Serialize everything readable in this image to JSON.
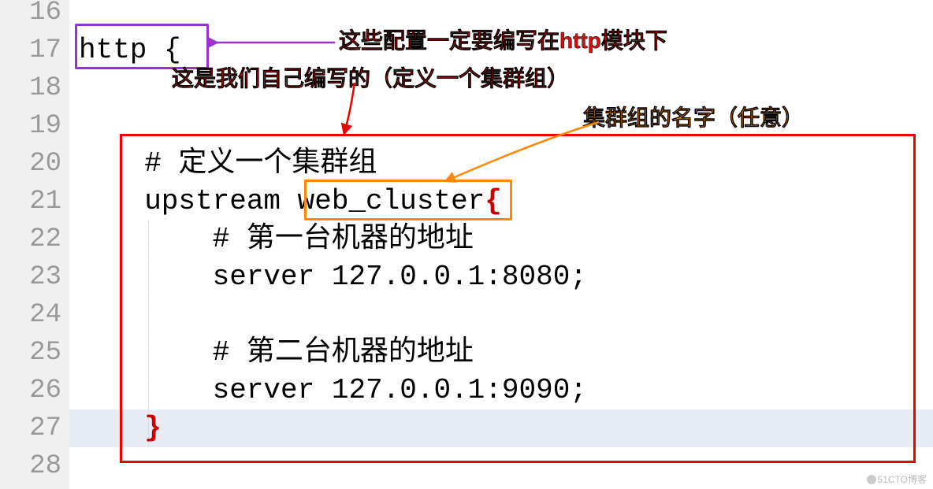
{
  "line_numbers": [
    "16",
    "17",
    "18",
    "19",
    "20",
    "21",
    "22",
    "23",
    "24",
    "25",
    "26",
    "27",
    "28"
  ],
  "code": {
    "l17": "http {",
    "l20": "  # 定义一个集群组",
    "l21_pre": "  upstream ",
    "l21_name": "web_cluster",
    "l21_brace": "{",
    "l22": "      # 第一台机器的地址",
    "l23": "      server 127.0.0.1:8080;",
    "l25": "      # 第二台机器的地址",
    "l26": "      server 127.0.0.1:9090;",
    "l27_brace": "  }"
  },
  "annotations": {
    "http_note": "这些配置一定要编写在http模块下",
    "self_written": "这是我们自己编写的（定义一个集群组）",
    "name_note": "集群组的名字（任意）"
  },
  "watermark": "51CTO博客"
}
